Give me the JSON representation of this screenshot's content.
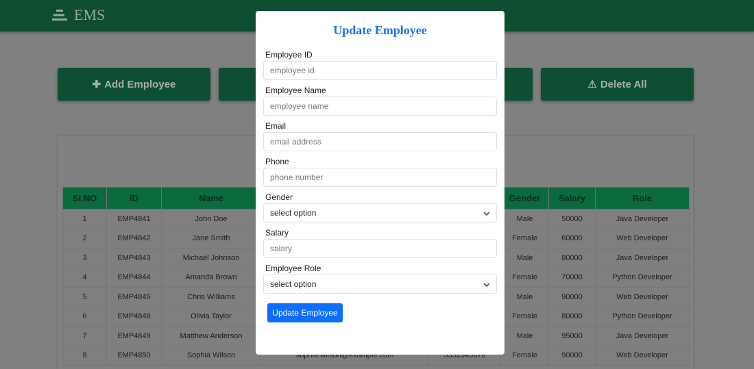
{
  "nav": {
    "brand": "EMS",
    "icon": "bars-staggered-icon"
  },
  "actions": [
    {
      "label": "Add Employee",
      "icon": "plus-icon"
    },
    {
      "label": "",
      "icon": "chart-area-icon"
    },
    {
      "label": "Delete All",
      "icon": "warning-triangle-icon"
    }
  ],
  "table": {
    "headers": [
      "SI.NO",
      "ID",
      "Name",
      "",
      "",
      "Gender",
      "Salary",
      "Role"
    ],
    "rows": [
      {
        "no": "1",
        "id": "EMP4841",
        "name": "John Doe",
        "gender": "Male",
        "salary": "50000",
        "role": "Java Developer"
      },
      {
        "no": "2",
        "id": "EMP4842",
        "name": "Jane Smith",
        "gender": "Female",
        "salary": "60000",
        "role": "Web Developer"
      },
      {
        "no": "3",
        "id": "EMP4843",
        "name": "Michael Johnson",
        "gender": "Male",
        "salary": "80000",
        "role": "Java Developer"
      },
      {
        "no": "4",
        "id": "EMP4844",
        "name": "Amanda Brown",
        "gender": "Female",
        "salary": "70000",
        "role": "Python Developer"
      },
      {
        "no": "5",
        "id": "EMP4845",
        "name": "Chris Williams",
        "gender": "Male",
        "salary": "90000",
        "role": "Web Developer"
      },
      {
        "no": "6",
        "id": "EMP4848",
        "name": "Olivia Taylor",
        "gender": "Female",
        "salary": "80000",
        "role": "Python Developer"
      },
      {
        "no": "7",
        "id": "EMP4849",
        "name": "Matthew Anderson",
        "gender": "Male",
        "salary": "95000",
        "role": "Java Developer"
      },
      {
        "no": "8",
        "id": "EMP4850",
        "name": "Sophia Wilson",
        "email": "sophia.wilson@example.com",
        "phone": "5552345678",
        "gender": "Female",
        "salary": "90000",
        "role": "Web Developer"
      }
    ]
  },
  "modal": {
    "title": "Update Employee",
    "fields": [
      {
        "label": "Employee ID",
        "placeholder": "employee id"
      },
      {
        "label": "Employee Name",
        "placeholder": "employee name"
      },
      {
        "label": "Email",
        "placeholder": "email address"
      },
      {
        "label": "Phone",
        "placeholder": "phone number"
      },
      {
        "label": "Gender",
        "value": "select option",
        "type": "select"
      },
      {
        "label": "Salary",
        "placeholder": "salary"
      },
      {
        "label": "Employee Role",
        "value": "select option",
        "type": "select"
      }
    ],
    "submit": "Update Employee"
  }
}
